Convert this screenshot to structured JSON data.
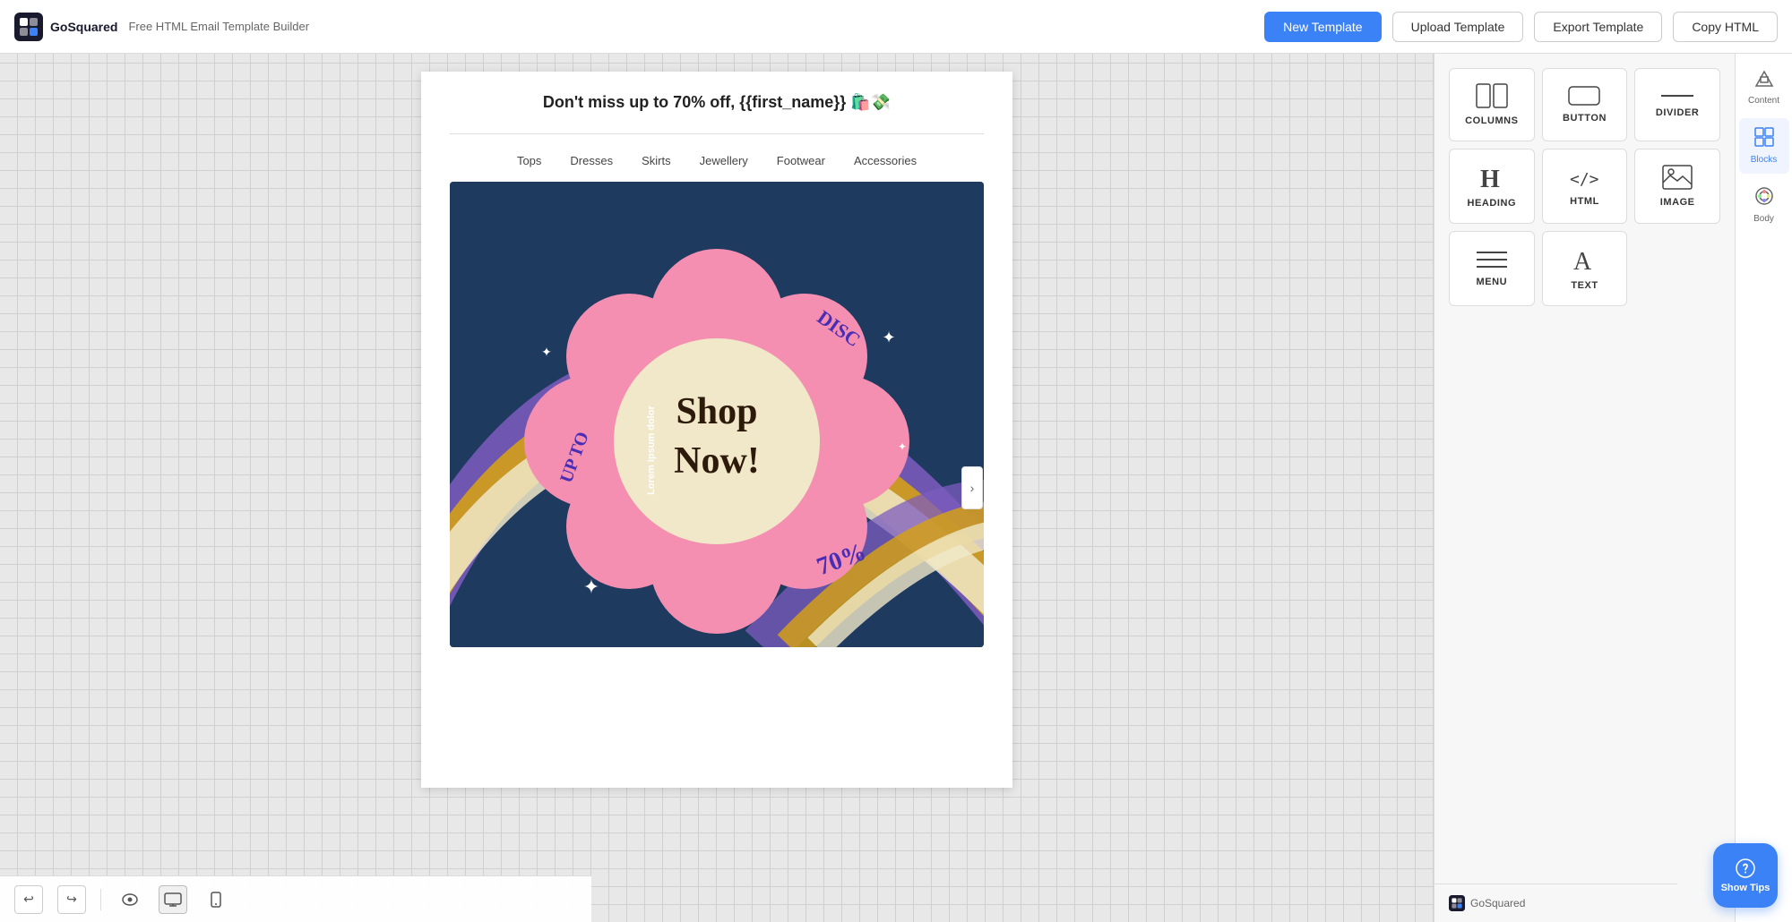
{
  "app": {
    "logo_text": "GoSquared",
    "app_title": "Free HTML Email Template Builder"
  },
  "toolbar": {
    "new_template": "New Template",
    "upload_template": "Upload Template",
    "export_template": "Export Template",
    "copy_html": "Copy HTML"
  },
  "email": {
    "subject": "Don't miss up to 70% off, {{first_name}} 🛍️💸",
    "nav_items": [
      "Tops",
      "Dresses",
      "Skirts",
      "Jewellery",
      "Footwear",
      "Accessories"
    ],
    "image_alt": "Shop Now promotional banner",
    "lorem_text": "Lorem ipsum dolor",
    "discount_text": "DISC",
    "upto_text": "UP TO",
    "shop_now_text": "Shop Now!",
    "percent_text": "70%"
  },
  "bottom_toolbar": {
    "undo_label": "↩",
    "redo_label": "↪",
    "preview_label": "👁",
    "desktop_label": "🖥",
    "mobile_label": "📱"
  },
  "blocks_panel": {
    "items": [
      {
        "id": "columns",
        "label": "COLUMNS",
        "icon": "columns"
      },
      {
        "id": "button",
        "label": "BUTTON",
        "icon": "button"
      },
      {
        "id": "divider",
        "label": "DIVIDER",
        "icon": "divider"
      },
      {
        "id": "heading",
        "label": "HEADING",
        "icon": "heading"
      },
      {
        "id": "html",
        "label": "HTML",
        "icon": "html"
      },
      {
        "id": "image",
        "label": "IMAGE",
        "icon": "image"
      },
      {
        "id": "menu",
        "label": "MENU",
        "icon": "menu"
      },
      {
        "id": "text",
        "label": "TEXT",
        "icon": "text"
      }
    ]
  },
  "side_tabs": [
    {
      "id": "content",
      "label": "Content",
      "icon": "△□"
    },
    {
      "id": "blocks",
      "label": "Blocks",
      "icon": "⊞",
      "active": true
    },
    {
      "id": "body",
      "label": "Body",
      "icon": "🎨"
    }
  ],
  "panel_footer": {
    "gosquared_label": "GoSquared"
  },
  "show_tips": {
    "label": "Show Tips"
  }
}
